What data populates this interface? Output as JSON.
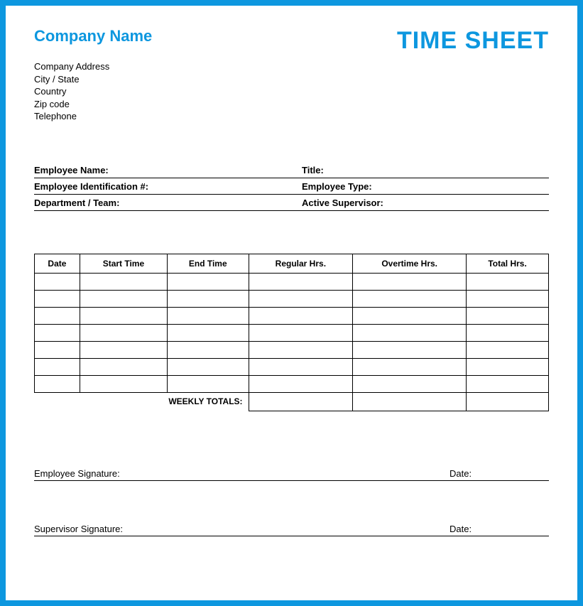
{
  "header": {
    "company_name": "Company Name",
    "doc_title": "TIME SHEET"
  },
  "company_info": {
    "address": "Company Address",
    "city_state": "City / State",
    "country": "Country",
    "zip": "Zip code",
    "telephone": "Telephone"
  },
  "employee": {
    "name_label": "Employee Name:",
    "title_label": "Title:",
    "id_label": "Employee Identification #:",
    "type_label": "Employee Type:",
    "dept_label": "Department / Team:",
    "supervisor_label": "Active Supervisor:"
  },
  "table": {
    "headers": {
      "date": "Date",
      "start": "Start Time",
      "end": "End Time",
      "regular": "Regular Hrs.",
      "overtime": "Overtime Hrs.",
      "total": "Total Hrs."
    },
    "rows": [
      {
        "date": "",
        "start": "",
        "end": "",
        "regular": "",
        "overtime": "",
        "total": ""
      },
      {
        "date": "",
        "start": "",
        "end": "",
        "regular": "",
        "overtime": "",
        "total": ""
      },
      {
        "date": "",
        "start": "",
        "end": "",
        "regular": "",
        "overtime": "",
        "total": ""
      },
      {
        "date": "",
        "start": "",
        "end": "",
        "regular": "",
        "overtime": "",
        "total": ""
      },
      {
        "date": "",
        "start": "",
        "end": "",
        "regular": "",
        "overtime": "",
        "total": ""
      },
      {
        "date": "",
        "start": "",
        "end": "",
        "regular": "",
        "overtime": "",
        "total": ""
      },
      {
        "date": "",
        "start": "",
        "end": "",
        "regular": "",
        "overtime": "",
        "total": ""
      }
    ],
    "totals_label": "WEEKLY TOTALS:",
    "totals": {
      "regular": "",
      "overtime": "",
      "total": ""
    }
  },
  "signatures": {
    "employee_label": "Employee Signature:",
    "supervisor_label": "Supervisor Signature:",
    "date_label": "Date:"
  }
}
